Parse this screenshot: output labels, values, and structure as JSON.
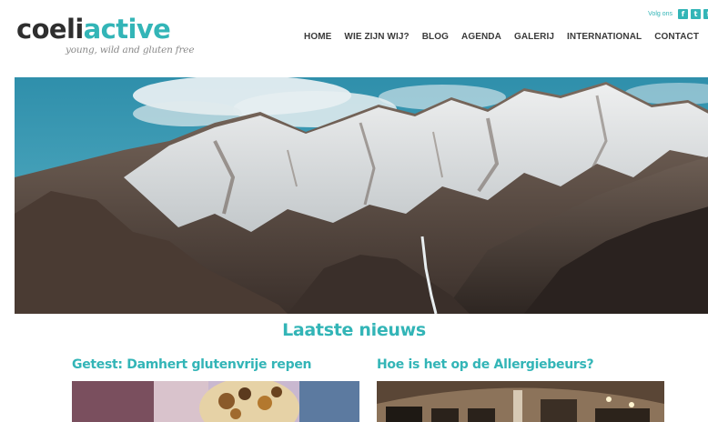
{
  "header": {
    "logo": {
      "part1": "coeli",
      "part2": "active",
      "tagline": "young, wild and gluten free"
    },
    "social": {
      "label": "Volg ons",
      "icons": [
        "facebook-icon",
        "twitter-icon",
        "facebook-icon"
      ]
    },
    "nav": [
      "HOME",
      "WIE ZIJN WIJ?",
      "BLOG",
      "AGENDA",
      "GALERIJ",
      "INTERNATIONAL",
      "CONTACT"
    ]
  },
  "news": {
    "heading": "Laatste nieuws",
    "articles": [
      {
        "title": "Getest: Damhert glutenvrije repen"
      },
      {
        "title": "Hoe is het op de Allergiebeurs?"
      }
    ]
  },
  "colors": {
    "accent": "#33b5b7",
    "text_dark": "#2e2e2e",
    "sky": "#3a9ab2"
  }
}
